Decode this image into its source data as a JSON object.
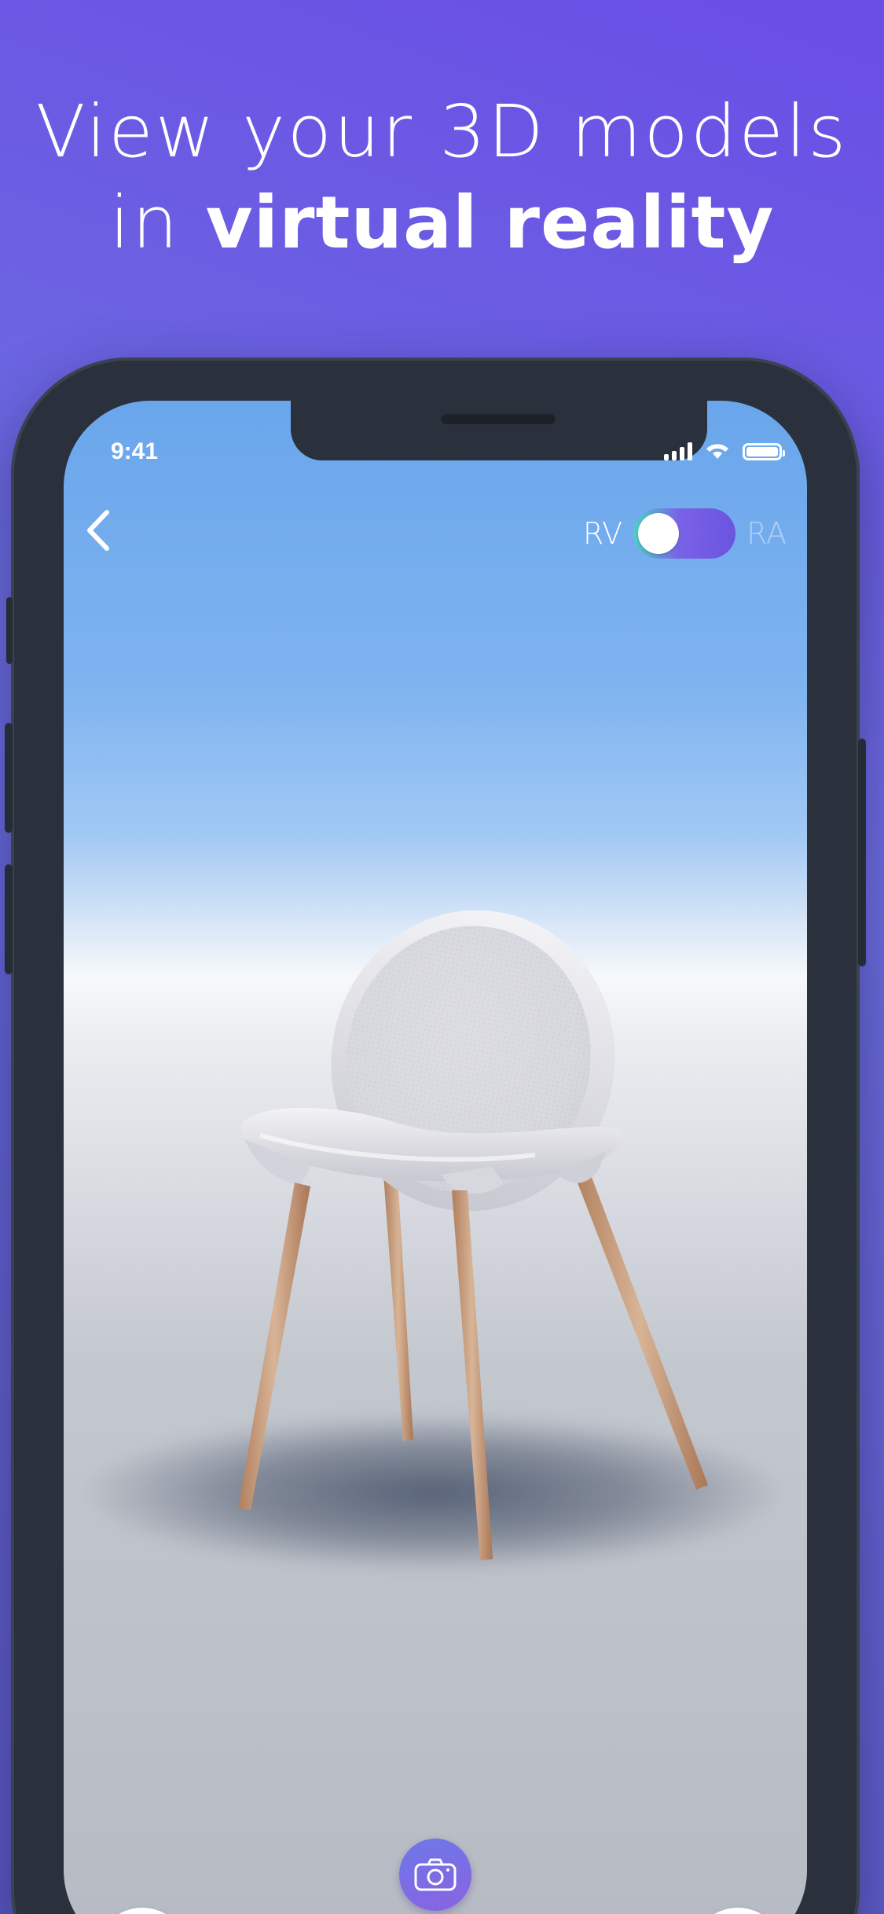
{
  "promo": {
    "headline_line1": "View your 3D models",
    "headline_in": "in ",
    "headline_bold": "virtual reality"
  },
  "status_bar": {
    "time": "9:41",
    "icons": [
      "cellular-signal-icon",
      "wifi-icon",
      "battery-icon"
    ]
  },
  "nav": {
    "back_icon": "chevron-left-icon"
  },
  "view_mode": {
    "left_label": "RV",
    "right_label": "RA",
    "selected": "RV"
  },
  "model": {
    "name_icon": "chair-model"
  },
  "bottom_bar": {
    "capture_icon": "camera-icon",
    "left_icon": "rotate-icon",
    "right_icon": "reset-icon"
  },
  "colors": {
    "background_top": "#6a4de6",
    "phone_body": "#2a313c",
    "sky_blue": "#6aa6ec",
    "toggle_teal": "#4ed1c5",
    "toggle_purple": "#6a55e0",
    "camera_button": "#7a6ce6"
  }
}
